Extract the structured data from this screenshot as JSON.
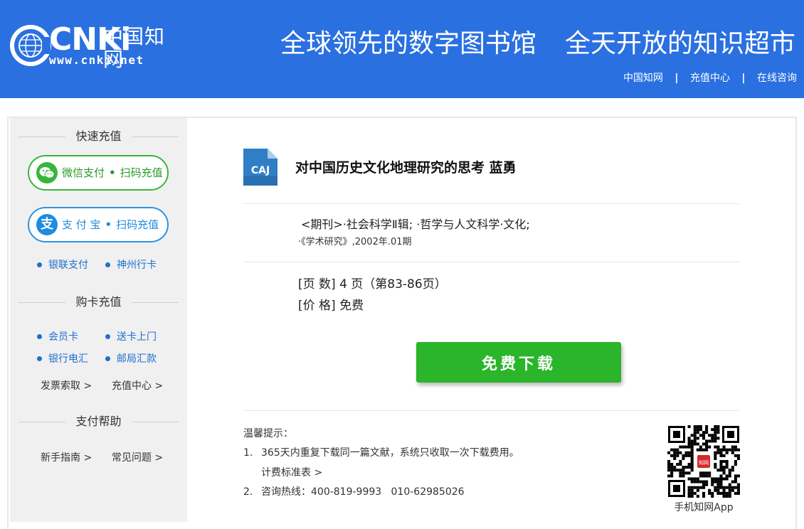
{
  "header": {
    "logo_text": "CNKi",
    "logo_cn": "中国知网",
    "logo_url": "www.cnki.net",
    "slogan_1": "全球领先的数字图书馆",
    "slogan_2": "全天开放的知识超市",
    "links": [
      "中国知网",
      "充值中心",
      "在线咨询"
    ],
    "separator": "|"
  },
  "sidebar": {
    "quick_recharge_title": "快速充值",
    "wechat_label": "微信支付",
    "wechat_action": "扫码充值",
    "alipay_label": "支 付 宝",
    "alipay_action": "扫码充值",
    "alipay_icon_char": "支",
    "bullet_sep": "•",
    "quick_links": [
      "银联支付",
      "神州行卡"
    ],
    "card_recharge_title": "购卡充值",
    "card_links": [
      "会员卡",
      "送卡上门",
      "银行电汇",
      "邮局汇款"
    ],
    "account_links": [
      "发票索取 >",
      "充值中心 >"
    ],
    "help_title": "支付帮助",
    "help_links": [
      "新手指南 >",
      "常见问题 >"
    ]
  },
  "document": {
    "icon_label": "CAJ",
    "title": "对中国历史文化地理研究的思考 蓝勇",
    "meta_line1": "<期刊>·社会科学Ⅱ辑; ·哲学与人文科学·文化;",
    "meta_line2": "·《学术研究》,2002年.01期",
    "pages": "[页 数] 4 页（第83-86页）",
    "price": "[价 格] 免费",
    "download_label": "免费下载"
  },
  "tips": {
    "title": "温馨提示：",
    "items": [
      {
        "num": "1.",
        "text": "365天内重复下载同一篇文献，系统只收取一次下载费用。"
      },
      {
        "num": "2.",
        "text": "咨询热线：400-819-9993   010-62985026"
      }
    ],
    "fee_link": "计费标准表 >",
    "qr_label": "手机知网App",
    "qr_badge": "知网"
  },
  "colors": {
    "header_bg": "#2a70e0",
    "wechat_green": "#3ab53a",
    "alipay_blue": "#1e8ce0",
    "link_blue": "#1e6fd0",
    "download_green": "#2ab52a"
  }
}
